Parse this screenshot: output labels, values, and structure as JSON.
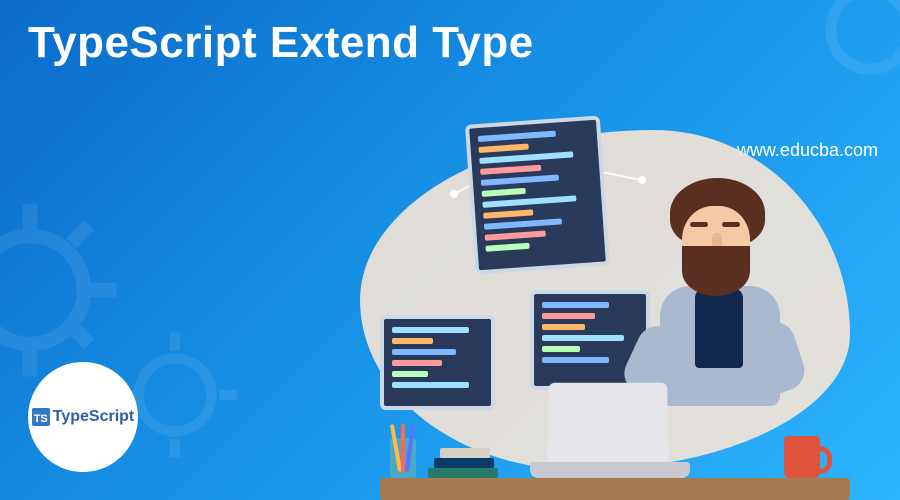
{
  "title": "TypeScript Extend Type",
  "site_url": "www.educba.com",
  "logo": {
    "text": "TypeScript",
    "badge": "TS"
  }
}
